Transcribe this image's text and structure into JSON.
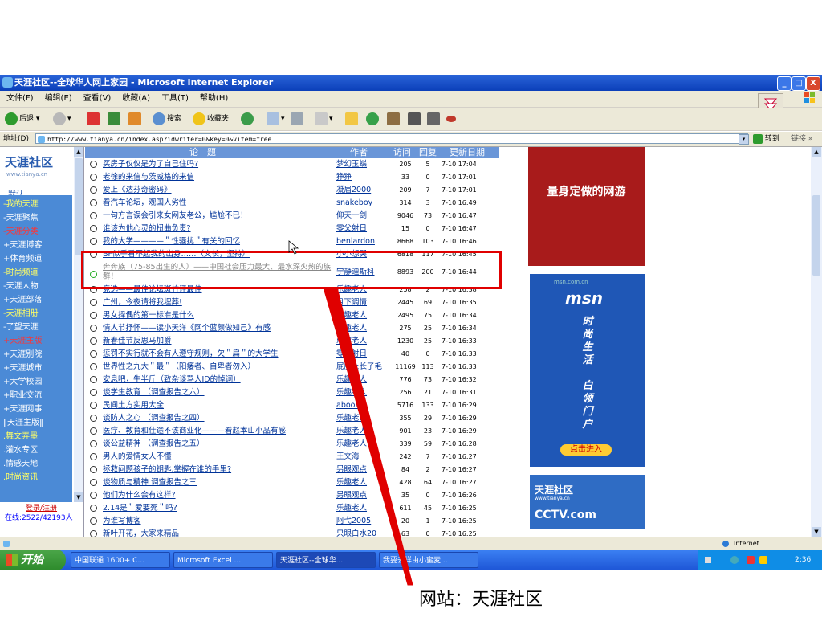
{
  "window": {
    "title": "天涯社区--全球华人网上家园 - Microsoft Internet Explorer",
    "controls": {
      "min": "_",
      "max": "□",
      "close": "X"
    }
  },
  "menu": [
    "文件(F)",
    "编辑(E)",
    "查看(V)",
    "收藏(A)",
    "工具(T)",
    "帮助(H)"
  ],
  "toolbar": {
    "back": "后退",
    "search": "搜索",
    "favorites": "收藏夹"
  },
  "address": {
    "label": "地址(D)",
    "url": "http://www.tianya.cn/index.asp?idwriter=0&key=0&vitem=free",
    "go": "转到",
    "links": "链接"
  },
  "site": {
    "logo": "天涯社区",
    "logo_sub": "www.tianya.cn",
    "tabs": [
      "默认",
      "分类"
    ],
    "nav": [
      {
        "label": "-我的天涯",
        "style": "y"
      },
      {
        "label": "-天涯聚焦",
        "style": "w"
      },
      {
        "label": "-天涯分类",
        "style": "r"
      },
      {
        "label": "+天涯博客",
        "style": "w"
      },
      {
        "label": "+体育频道",
        "style": "w"
      },
      {
        "label": "-时尚频道",
        "style": "y"
      },
      {
        "label": "-天涯人物",
        "style": "w"
      },
      {
        "label": "+天涯部落",
        "style": "w"
      },
      {
        "label": "-天涯相册",
        "style": "y"
      },
      {
        "label": "-了望天涯",
        "style": "w"
      },
      {
        "label": "+天涯主版",
        "style": "r"
      },
      {
        "label": "+天涯别院",
        "style": "w"
      },
      {
        "label": "+天涯城市",
        "style": "w"
      },
      {
        "label": "+大学校园",
        "style": "w"
      },
      {
        "label": "+职业交流",
        "style": "w"
      },
      {
        "label": "+天涯网事",
        "style": "w"
      },
      {
        "label": "‖天涯主版‖",
        "style": "w"
      },
      {
        "label": ".舞文弄墨",
        "style": "y"
      },
      {
        "label": ".灌水专区",
        "style": "w"
      },
      {
        "label": ".情感天地",
        "style": "w"
      },
      {
        "label": ".时尚资讯",
        "style": "y"
      }
    ],
    "login": "登录/注册",
    "online": "在线:2522/42193人"
  },
  "table": {
    "headers": {
      "title": "论　题",
      "author": "作者",
      "visits": "访问",
      "replies": "回复",
      "updated": "更新日期"
    },
    "rows": [
      {
        "title": "买房子仅仅是为了自己住吗?",
        "author": "梦幻玉蝶",
        "visits": "205",
        "replies": "5",
        "date": "7-10 17:04"
      },
      {
        "title": "老徐的来信与茨威格的来信",
        "author": "狰狰",
        "visits": "33",
        "replies": "0",
        "date": "7-10 17:01"
      },
      {
        "title": "爱上《达芬奇密码》",
        "author": "凝眉2000",
        "visits": "209",
        "replies": "7",
        "date": "7-10 17:01"
      },
      {
        "title": "看汽车论坛，观国人劣性",
        "author": "snakeboy",
        "visits": "314",
        "replies": "3",
        "date": "7-10 16:49"
      },
      {
        "title": "一句方言误会引来女网友老公，尴尬不已！",
        "author": "仰天一剑",
        "visits": "9046",
        "replies": "73",
        "date": "7-10 16:47"
      },
      {
        "title": "谁该为他心灵的扭曲负责?",
        "author": "零父射日",
        "visits": "15",
        "replies": "0",
        "date": "7-10 16:47"
      },
      {
        "title": "我的大学————＂性骚扰＂有关的回忆",
        "author": "benlardon",
        "visits": "8668",
        "replies": "103",
        "date": "7-10 16:46"
      },
      {
        "title": "BF似乎看不起我的出身……（文长，坚持）",
        "author": "小小想哭",
        "visits": "6818",
        "replies": "117",
        "date": "7-10 16:45"
      },
      {
        "title": "奔奔族（75-85出生的人）——中国社会压力最大、最水深火热的族群！",
        "author": "宁静迪斯科",
        "visits": "8893",
        "replies": "200",
        "date": "7-10 16:44"
      },
      {
        "title": "竞选——最佳论坛斑竹评最佳",
        "author": "乐趣老人",
        "visits": "258",
        "replies": "2",
        "date": "7-10 16:38"
      },
      {
        "title": "广州，今夜请将我埋葬!",
        "author": "月下调情",
        "visits": "2445",
        "replies": "69",
        "date": "7-10 16:35"
      },
      {
        "title": "男女择偶的第一标准是什么",
        "author": "乐趣老人",
        "visits": "2495",
        "replies": "75",
        "date": "7-10 16:34"
      },
      {
        "title": "情人节抒怀——读小天洋《网个蓝颜做知己》有感",
        "author": "乐趣老人",
        "visits": "275",
        "replies": "25",
        "date": "7-10 16:34"
      },
      {
        "title": "新春佳节反思马加爵",
        "author": "乐趣老人",
        "visits": "1230",
        "replies": "25",
        "date": "7-10 16:33"
      },
      {
        "title": "惩罚不实行就不会有人遵守规则，欠＂扁＂的大学生",
        "author": "零父射日",
        "visits": "40",
        "replies": "0",
        "date": "7-10 16:33"
      },
      {
        "title": "世界性之九大＂最＂（阳痿者、自卑者勿入）",
        "author": "屁股上长了毛",
        "visits": "11169",
        "replies": "113",
        "date": "7-10 16:33"
      },
      {
        "title": "安息吧，牛半斤（致杂谈骂人ID的悼词）",
        "author": "乐趣老人",
        "visits": "776",
        "replies": "73",
        "date": "7-10 16:32"
      },
      {
        "title": "谈学生教育 （调查报告之六）",
        "author": "乐趣老人",
        "visits": "256",
        "replies": "21",
        "date": "7-10 16:31"
      },
      {
        "title": "民间土方实用大全",
        "author": "aboom",
        "visits": "5716",
        "replies": "133",
        "date": "7-10 16:29"
      },
      {
        "title": "谈防人之心 （调查报告之四）",
        "author": "乐趣老人",
        "visits": "355",
        "replies": "29",
        "date": "7-10 16:29"
      },
      {
        "title": "医疗、教育和仕途不该商业化———看赵本山小品有感",
        "author": "乐趣老人",
        "visits": "901",
        "replies": "23",
        "date": "7-10 16:29"
      },
      {
        "title": "谈公益精神 （调查报告之五）",
        "author": "乐趣老人",
        "visits": "339",
        "replies": "59",
        "date": "7-10 16:28"
      },
      {
        "title": "男人的爱情女人不懂",
        "author": "王文海",
        "visits": "242",
        "replies": "7",
        "date": "7-10 16:27"
      },
      {
        "title": "拯救问题孩子的钥匙,掌握在谁的手里?",
        "author": "另眼观点",
        "visits": "84",
        "replies": "2",
        "date": "7-10 16:27"
      },
      {
        "title": "谈物质与精神 调查报告之三",
        "author": "乐趣老人",
        "visits": "428",
        "replies": "64",
        "date": "7-10 16:27"
      },
      {
        "title": "他们为什么会有这样?",
        "author": "另眼观点",
        "visits": "35",
        "replies": "0",
        "date": "7-10 16:26"
      },
      {
        "title": "2.14是＂爱要死＂吗?",
        "author": "乐趣老人",
        "visits": "611",
        "replies": "45",
        "date": "7-10 16:25"
      },
      {
        "title": "为谁写博客",
        "author": "阿弋2005",
        "visits": "20",
        "replies": "1",
        "date": "7-10 16:25"
      },
      {
        "title": "新叶开花，大家来精品",
        "author": "只眼白水20",
        "visits": "63",
        "replies": "0",
        "date": "7-10 16:25"
      }
    ]
  },
  "ads": {
    "ad1": "量身定做的网游",
    "ad2_brand": "msn",
    "ad2_sub": "msn.com.cn",
    "ad2_lines": [
      "时",
      "尚",
      "生",
      "活",
      "",
      "白",
      "领",
      "门",
      "户"
    ],
    "ad2_button": "点击进入",
    "ad3_title": "天涯社区",
    "ad3_url": "www.tianya.cn",
    "ad3_cctv": "CCTV.com"
  },
  "status": {
    "zone": "Internet"
  },
  "taskbar": {
    "start": "开始",
    "tasks": [
      "中国联通 1600+ C...",
      "Microsoft Excel ...",
      "天涯社区--全球华...",
      "我要去样由小蜜麦..."
    ],
    "clock": "2:36"
  },
  "caption": "网站：天涯社区",
  "colors": {
    "highlight": "#e00000",
    "nav_bg": "#4b8ad6",
    "header_bg": "#6a96d8"
  }
}
